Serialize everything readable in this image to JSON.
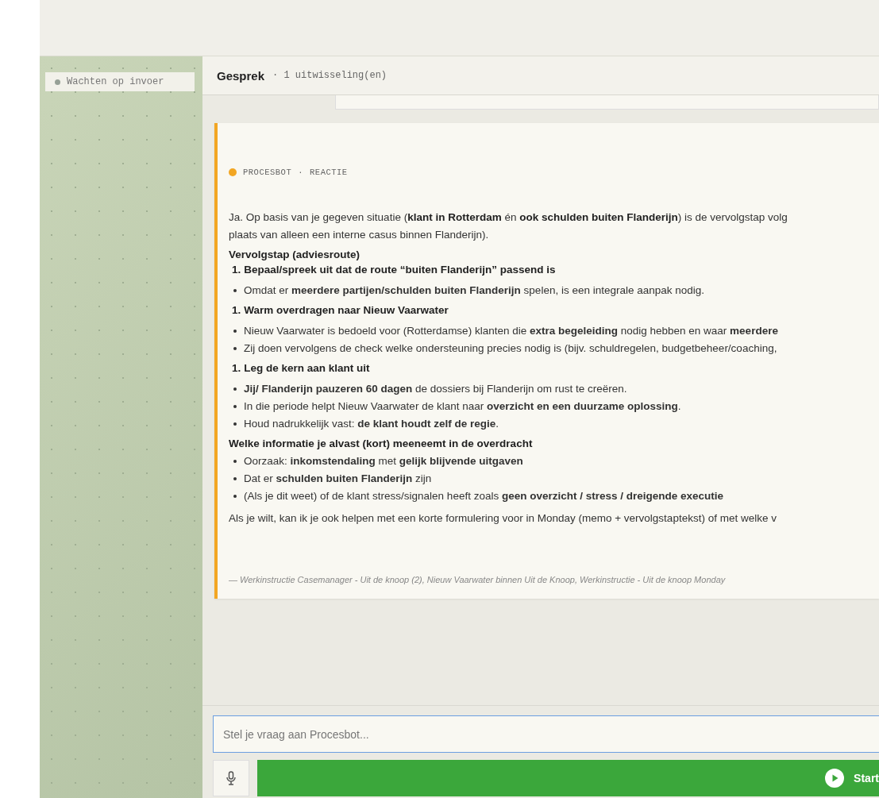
{
  "status": {
    "label": "Wachten op invoer"
  },
  "header": {
    "title": "Gesprek",
    "meta": "· 1 uitwisseling(en)"
  },
  "message": {
    "sender": "PROCESBOT",
    "separator": "·",
    "type": "REACTIE",
    "blocks": [
      {
        "kind": "paragraph",
        "lines": [
          "Ja. Op basis van je gegeven situatie (**klant in Rotterdam** én **ook schulden buiten Flanderijn**) is de vervolgstap volg",
          "plaats van alleen een interne casus binnen Flanderijn)."
        ]
      },
      {
        "kind": "heading",
        "text": "Vervolgstap (adviesroute)"
      },
      {
        "kind": "numbered",
        "number": "1.",
        "text": "Bepaal/spreek uit dat de route “buiten Flanderijn” passend is"
      },
      {
        "kind": "bullets",
        "items": [
          "Omdat er **meerdere partijen/schulden buiten Flanderijn** spelen, is een integrale aanpak nodig."
        ]
      },
      {
        "kind": "numbered",
        "number": "1.",
        "text": "Warm overdragen naar Nieuw Vaarwater"
      },
      {
        "kind": "bullets",
        "items": [
          "Nieuw Vaarwater is bedoeld voor (Rotterdamse) klanten die **extra begeleiding** nodig hebben en waar **meerdere**",
          "Zij doen vervolgens de check welke ondersteuning precies nodig is (bijv. schuldregelen, budgetbeheer/coaching,"
        ]
      },
      {
        "kind": "numbered",
        "number": "1.",
        "text": "Leg de kern aan klant uit"
      },
      {
        "kind": "bullets",
        "items": [
          "**Jij/ Flanderijn pauzeren 60 dagen** de dossiers bij Flanderijn om rust te creëren.",
          "In die periode helpt Nieuw Vaarwater de klant naar **overzicht en een duurzame oplossing**.",
          "Houd nadrukkelijk vast: **de klant houdt zelf de regie**."
        ]
      },
      {
        "kind": "heading",
        "text": "Welke informatie je alvast (kort) meeneemt in de overdracht"
      },
      {
        "kind": "bullets",
        "items": [
          "Oorzaak: **inkomstendaling** met **gelijk blijvende uitgaven**",
          "Dat er **schulden buiten Flanderijn** zijn",
          "(Als je dit weet) of de klant stress/signalen heeft zoals **geen overzicht / stress / dreigende executie**"
        ]
      },
      {
        "kind": "paragraph",
        "lines": [
          "Als je wilt, kan ik je ook helpen met een korte formulering voor in Monday (memo + vervolgstaptekst) of met welke v"
        ]
      }
    ],
    "sources": "— Werkinstructie Casemanager - Uit de knoop (2), Nieuw Vaarwater binnen Uit de Knoop, Werkinstructie - Uit de knoop Monday"
  },
  "composer": {
    "placeholder": "Stel je vraag aan Procesbot...",
    "start": "Start"
  }
}
